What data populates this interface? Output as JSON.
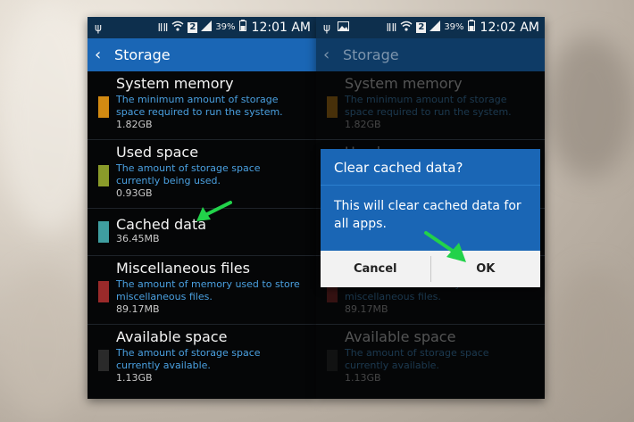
{
  "status_left": {
    "icons": [
      "usb-icon",
      "wifi-icon",
      "sim2-icon",
      "signal-icon",
      "battery-icon"
    ],
    "battery_pct": "39%",
    "time": "12:01 AM"
  },
  "status_right": {
    "icons": [
      "usb-icon",
      "image-icon",
      "wifi-icon",
      "sim2-icon",
      "signal-icon",
      "battery-icon"
    ],
    "battery_pct": "39%",
    "time": "12:02 AM"
  },
  "header": {
    "title": "Storage"
  },
  "storage_items": [
    {
      "title": "System memory",
      "desc_line1": "The minimum amount of storage",
      "desc_line2": "space required to run the system.",
      "size": "1.82GB",
      "color": "#d28a12"
    },
    {
      "title": "Used space",
      "desc_line1": "The amount of storage space",
      "desc_line2": "currently being used.",
      "size": "0.93GB",
      "color": "#8a9b2a"
    },
    {
      "title": "Cached data",
      "desc_line1": "",
      "desc_line2": "",
      "size": "36.45MB",
      "color": "#3f9ea0"
    },
    {
      "title": "Miscellaneous files",
      "desc_line1": "The amount of memory used to store",
      "desc_line2": "miscellaneous files.",
      "size": "89.17MB",
      "color": "#9a2a2a"
    },
    {
      "title": "Available space",
      "desc_line1": "The amount of storage space",
      "desc_line2": "currently available.",
      "size": "1.13GB",
      "color": "#2a2a2a"
    }
  ],
  "dialog": {
    "title": "Clear cached data?",
    "message": "This will clear cached data for all apps.",
    "cancel_label": "Cancel",
    "ok_label": "OK"
  },
  "colors": {
    "accent": "#1a66b5",
    "status_bar": "#0d2f4d",
    "desc_text": "#4aa0e0",
    "arrow": "#22d24a"
  }
}
